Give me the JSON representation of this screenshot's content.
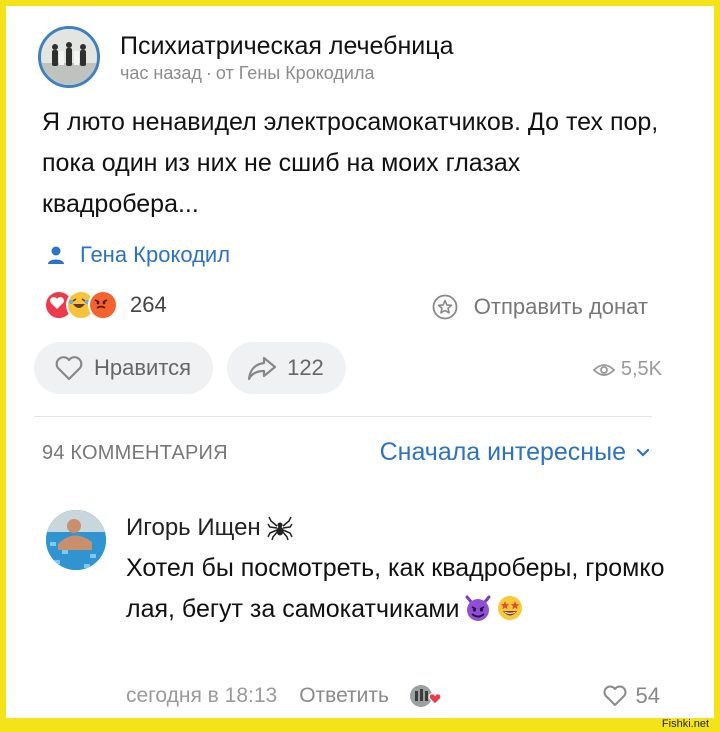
{
  "post": {
    "group_name": "Психиатрическая лечебница",
    "time": "час назад",
    "meta_separator": "·",
    "from": "от Гены Крокодила",
    "text": "Я люто ненавидел электросамокатчиков. До тех пор, пока один из них не сшиб на моих глазах квадробера...",
    "author": "Гена Крокодил",
    "reactions_count": "264",
    "donate_label": "Отправить донат",
    "like_label": "Нравится",
    "share_count": "122",
    "views": "5,5K"
  },
  "comments_section": {
    "count_label": "94 КОММЕНТАРИЯ",
    "sort_label": "Сначала интересные"
  },
  "comment": {
    "author": "Игорь Ищен",
    "text": "Хотел бы посмотреть, как квадроберы, громко лая, бегут за самокатчиками",
    "time": "сегодня в 18:13",
    "reply_label": "Ответить",
    "likes": "54"
  },
  "watermark": "Fishki.net",
  "colors": {
    "accent": "#2b72c8",
    "frame": "#f5e31a",
    "pill_bg": "#eff1f3"
  },
  "icons": [
    "person-icon",
    "heart-reaction-icon",
    "laugh-reaction-icon",
    "angry-reaction-icon",
    "donate-star-icon",
    "heart-outline-icon",
    "share-arrow-icon",
    "eye-icon",
    "chevron-down-icon",
    "spider-icon",
    "devil-emoji-icon",
    "starstruck-emoji-icon"
  ]
}
